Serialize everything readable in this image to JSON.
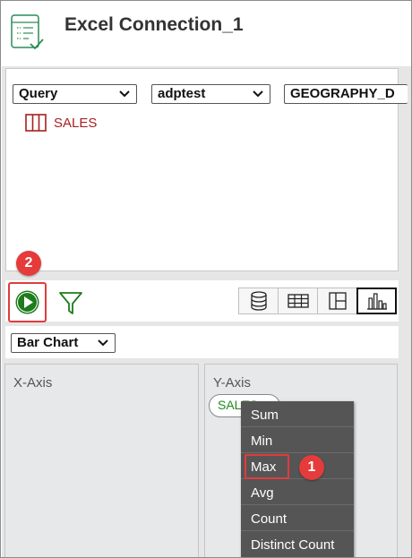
{
  "header": {
    "title": "Excel Connection_1",
    "icon": "spreadsheet-check-icon"
  },
  "query": {
    "type_select": "Query",
    "database_select": "adptest",
    "schema_select": "GEOGRAPHY_D",
    "tables": [
      {
        "label": "SALES",
        "icon": "table-icon"
      }
    ]
  },
  "toolbar": {
    "run_icon": "play-icon",
    "filter_icon": "filter-icon",
    "views": [
      "database-icon",
      "grid-icon",
      "layout-icon",
      "bar-chart-icon"
    ],
    "active_view": "bar-chart-icon"
  },
  "chart": {
    "type_select": "Bar Chart"
  },
  "axes": {
    "x_label": "X-Axis",
    "y_label": "Y-Axis",
    "y_field": "SALES"
  },
  "aggregate_menu": {
    "items": [
      "Sum",
      "Min",
      "Max",
      "Avg",
      "Count",
      "Distinct Count"
    ]
  },
  "annotations": {
    "step_1": "1",
    "step_2": "2"
  },
  "colors": {
    "accent_green": "#1e7b1e",
    "callout_red": "#e03c3c",
    "table_red": "#a52121",
    "menu_bg": "#555555"
  }
}
